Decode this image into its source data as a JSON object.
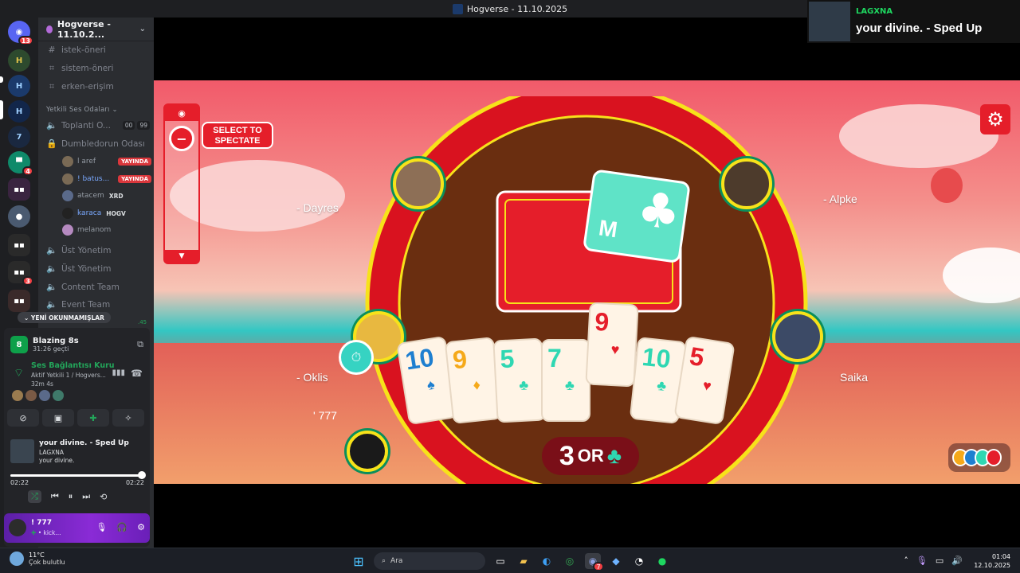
{
  "window": {
    "title": "Hogverse - 11.10.2025"
  },
  "servers": [
    {
      "name": "discord-home",
      "badge": "13"
    },
    {
      "name": "server-h1",
      "badge": ""
    },
    {
      "name": "server-h2",
      "badge": ""
    },
    {
      "name": "server-h3",
      "badge": ""
    },
    {
      "name": "server-7",
      "badge": ""
    },
    {
      "name": "server-flag",
      "badge": "4"
    },
    {
      "name": "server-group1",
      "badge": ""
    },
    {
      "name": "server-avatar",
      "badge": ""
    },
    {
      "name": "server-group2",
      "badge": "3"
    },
    {
      "name": "server-group3",
      "badge": ""
    }
  ],
  "sidebar": {
    "server_name": "Hogverse - 11.10.2...",
    "channels": [
      "istek-öneri",
      "sistem-öneri",
      "erken-erişim"
    ],
    "category": "Yetkili Ses Odaları",
    "voice_channels": [
      {
        "name": "Toplanti O...",
        "count1": "00",
        "count2": "99"
      },
      {
        "name": "Dumbledorun Odası"
      }
    ],
    "voice_users": [
      {
        "name": "l aref",
        "tag": "",
        "live": "YAYINDA"
      },
      {
        "name": "! batus...",
        "tag": "",
        "live": "YAYINDA"
      },
      {
        "name": "atacem",
        "tag": "XRD",
        "live": ""
      },
      {
        "name": "karaca",
        "tag": "HOGV",
        "live": ""
      },
      {
        "name": "melanom",
        "tag": "",
        "live": ""
      }
    ],
    "more_channels": [
      "Üst Yönetim",
      "Üst Yönetim",
      "Content Team",
      "Event Team"
    ],
    "unread_label": "YENİ OKUNMAMIŞLAR",
    "unread_count": ".45"
  },
  "activity": {
    "game": "Blazing 8s",
    "elapsed": "31:26 geçti"
  },
  "voice": {
    "status": "Ses Bağlantısı Kuru",
    "channel": "Aktif Yetkili 1 / Hogvers...",
    "duration": "32m 4s"
  },
  "music": {
    "title": "your divine. - Sped Up",
    "artist": "LAGXNA",
    "album": "your divine.",
    "time_current": "02:22",
    "time_total": "02:22",
    "progress": 1.0
  },
  "user": {
    "name": "! 777",
    "status": "• kick..."
  },
  "game": {
    "spectate_label": "SELECT TO SPECTATE",
    "players": [
      "- Dayres",
      "- Alpke",
      "- Oklis",
      "Saika",
      "' 777"
    ],
    "callout_number": "3",
    "callout_text": "OR",
    "callout_suit": "♣",
    "center_card": "M",
    "hand": [
      {
        "rank": "10",
        "suit": "♠",
        "color": "#1e7fd0"
      },
      {
        "rank": "9",
        "suit": "♦",
        "color": "#f5a91a"
      },
      {
        "rank": "5",
        "suit": "♣",
        "color": "#2fd7b2"
      },
      {
        "rank": "7",
        "suit": "♣",
        "color": "#2fd7b2"
      },
      {
        "rank": "9",
        "suit": "♥",
        "color": "#e51e2a"
      },
      {
        "rank": "10",
        "suit": "♣",
        "color": "#2fd7b2"
      },
      {
        "rank": "5",
        "suit": "♥",
        "color": "#e51e2a"
      }
    ]
  },
  "toast": {
    "artist": "LAGXNA",
    "title": "your divine. - Sped Up"
  },
  "taskbar": {
    "temp": "11°C",
    "weather": "Çok bulutlu",
    "search": "Ara",
    "time": "01:04",
    "date": "12.10.2025",
    "discord_badge": "7"
  }
}
